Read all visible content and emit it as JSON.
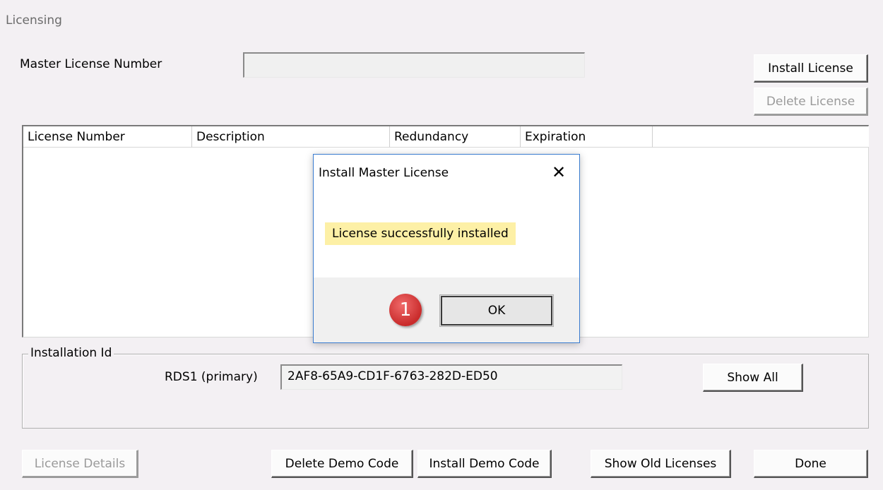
{
  "window": {
    "title": "Licensing"
  },
  "master_license": {
    "label": "Master License Number",
    "value": ""
  },
  "buttons": {
    "install_license": "Install License",
    "delete_license": "Delete License",
    "show_all": "Show All",
    "license_details": "License Details",
    "delete_demo_code": "Delete Demo Code",
    "install_demo_code": "Install Demo Code",
    "show_old_licenses": "Show Old Licenses",
    "done": "Done"
  },
  "license_table": {
    "columns": [
      "License Number",
      "Description",
      "Redundancy",
      "Expiration"
    ],
    "rows": []
  },
  "installation": {
    "group_label": "Installation Id",
    "server_label": "RDS1 (primary)",
    "id_value": "2AF8-65A9-CD1F-6763-282D-ED50"
  },
  "dialog": {
    "title": "Install Master License",
    "close_glyph": "✕",
    "message": "License successfully installed",
    "ok_label": "OK"
  },
  "annotation": {
    "step": "1",
    "color": "#d93636"
  }
}
